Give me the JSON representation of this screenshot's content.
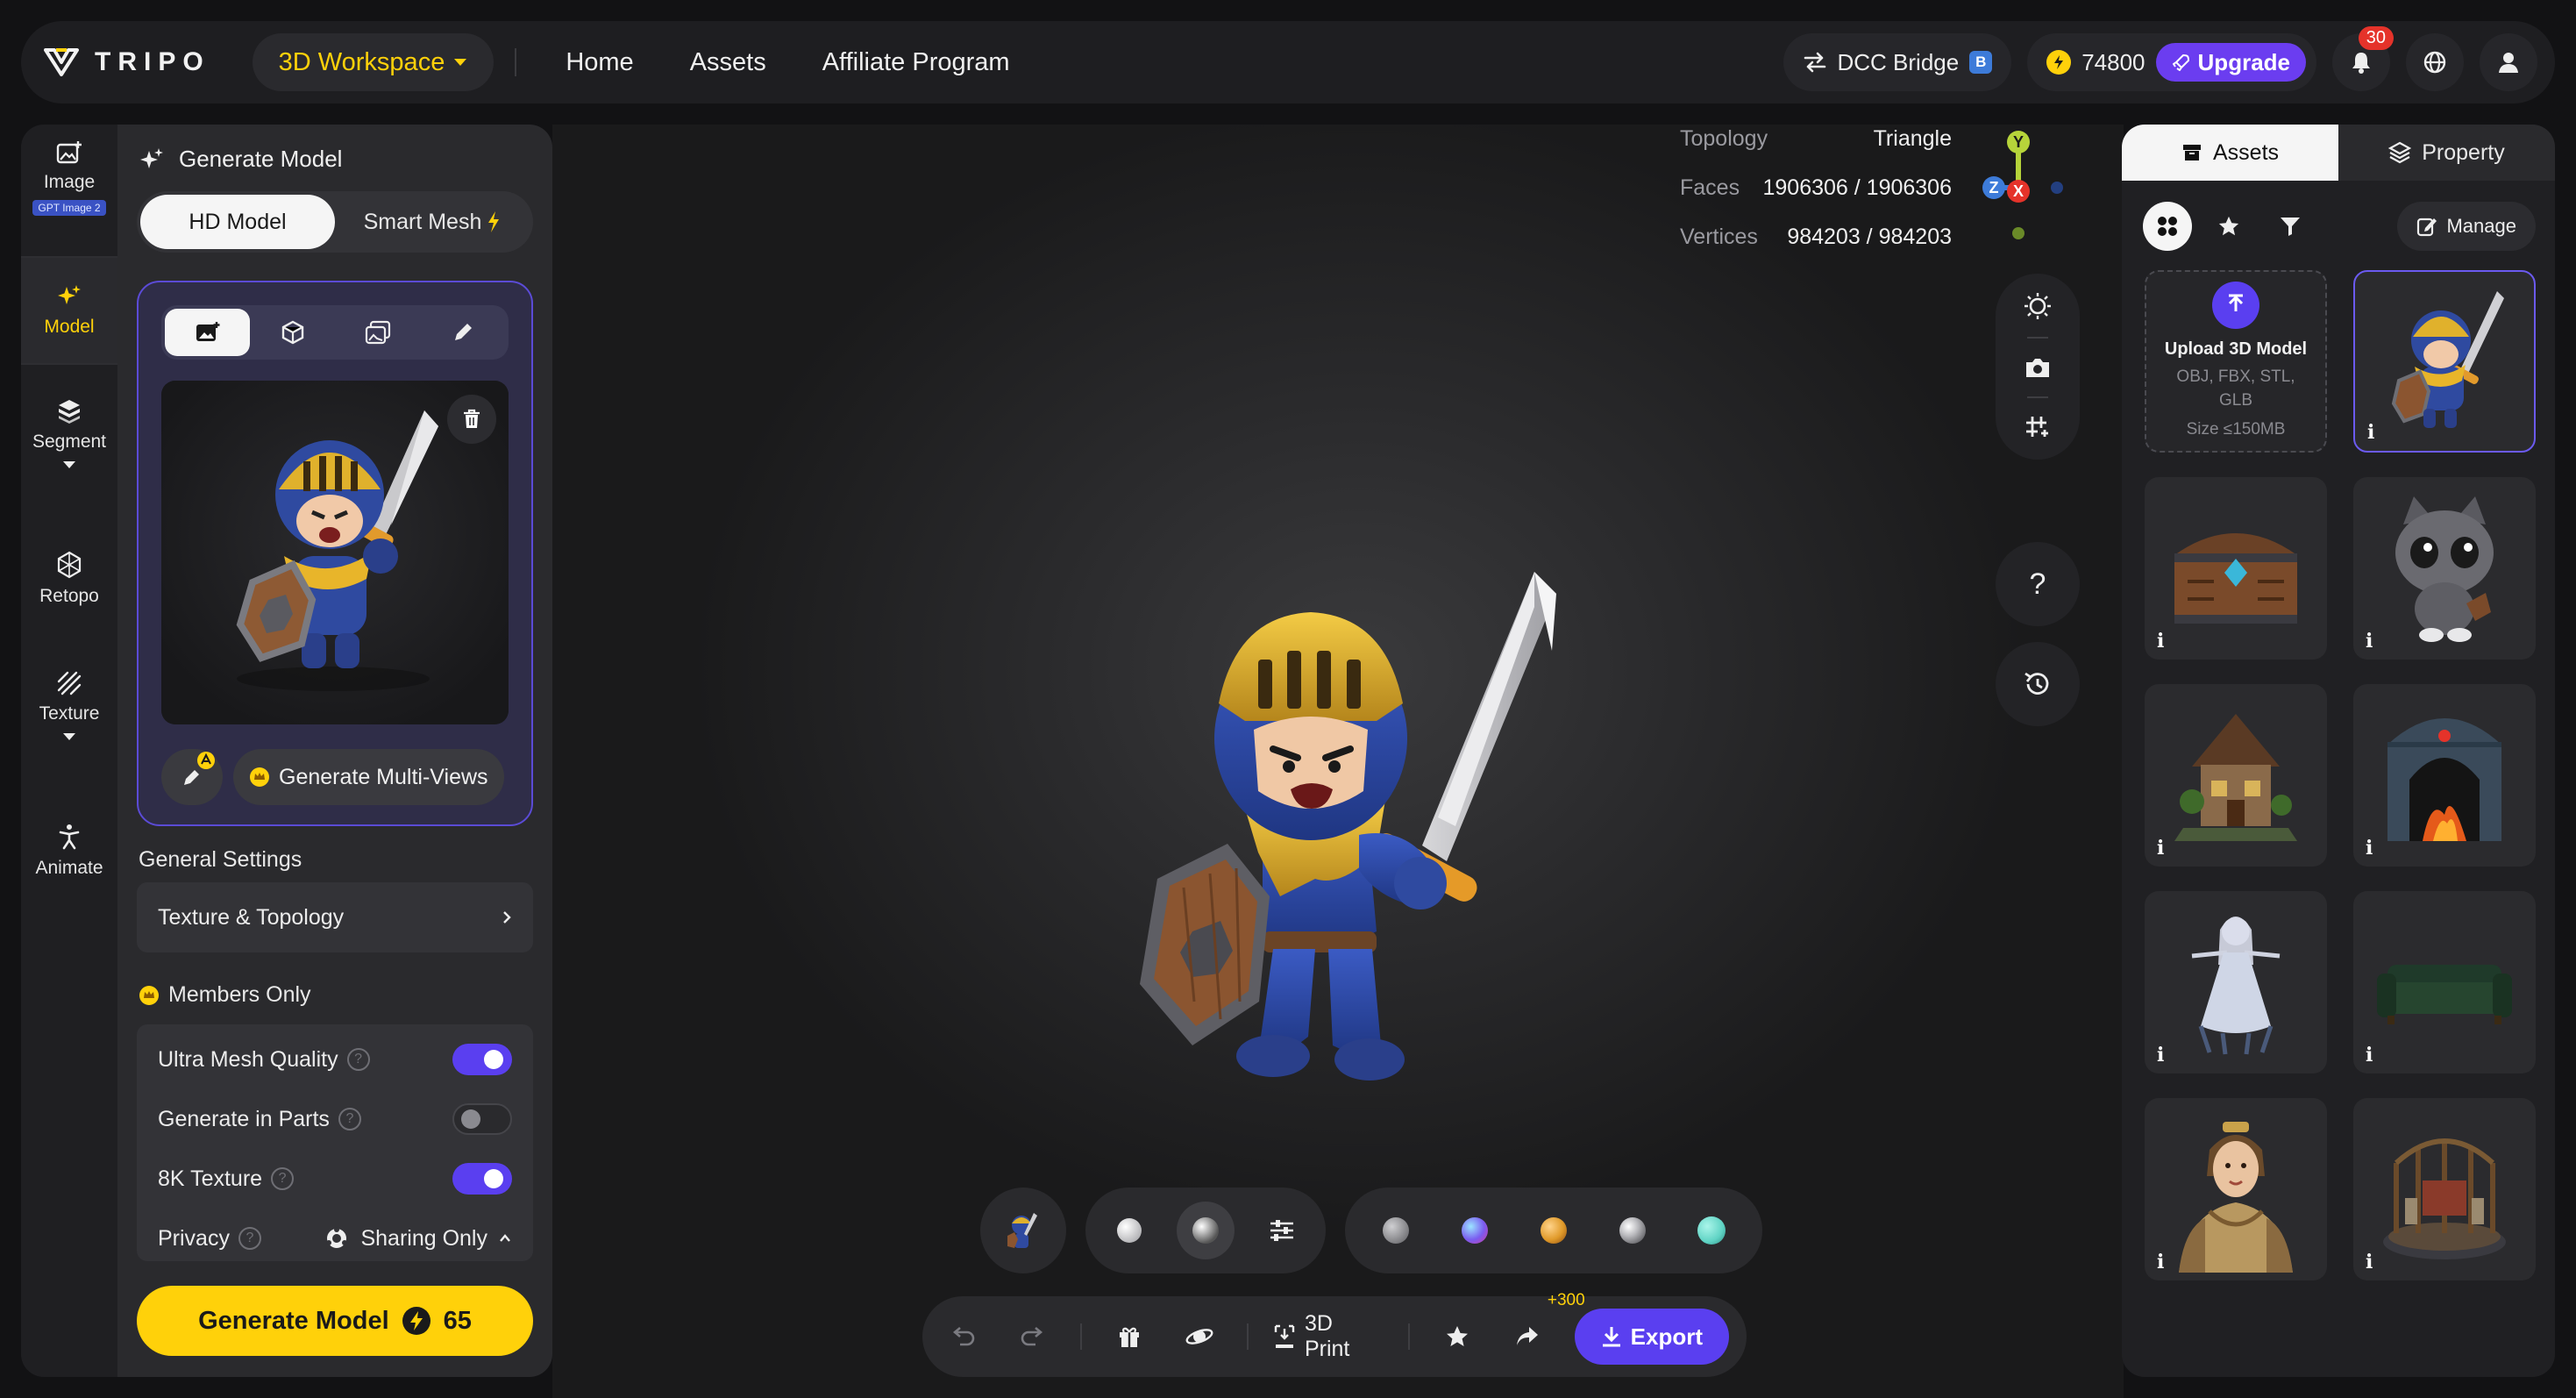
{
  "brand": {
    "name": "TRIPO"
  },
  "header": {
    "workspace_label": "3D Workspace",
    "nav": [
      "Home",
      "Assets",
      "Affiliate Program"
    ],
    "dcc_label": "DCC Bridge",
    "credits": "74800",
    "upgrade_label": "Upgrade",
    "notification_count": "30"
  },
  "rail": {
    "items": [
      {
        "label": "Image",
        "tag": "GPT Image 2"
      },
      {
        "label": "Model"
      },
      {
        "label": "Segment"
      },
      {
        "label": "Retopo"
      },
      {
        "label": "Texture"
      },
      {
        "label": "Animate"
      }
    ]
  },
  "panel": {
    "title": "Generate Model",
    "modes": [
      "HD Model",
      "Smart Mesh"
    ],
    "multiview_label": "Generate Multi-Views",
    "general_settings_label": "General Settings",
    "texture_topology_label": "Texture & Topology",
    "members_only_label": "Members Only",
    "settings": [
      {
        "label": "Ultra Mesh Quality",
        "on": true
      },
      {
        "label": "Generate in Parts",
        "on": false
      },
      {
        "label": "8K Texture",
        "on": true
      }
    ],
    "privacy_label": "Privacy",
    "privacy_value": "Sharing Only",
    "generate_label": "Generate Model",
    "generate_cost": "65"
  },
  "viewport": {
    "topology_label": "Topology",
    "topology_value": "Triangle",
    "faces_label": "Faces",
    "faces_value": "1906306 / 1906306",
    "vertices_label": "Vertices",
    "vertices_value": "984203 / 984203",
    "axis_labels": [
      "Y",
      "Z",
      "X"
    ],
    "help_label": "?",
    "print_label": "3D Print",
    "bonus_label": "+300",
    "export_label": "Export"
  },
  "colors": {
    "accent_yellow": "#ffd10a",
    "accent_purple": "#5a3ff0",
    "material_swatches": [
      "#cfcfd2",
      "#8a8a8e",
      "#7a5cf0",
      "#e09a2a",
      "#b8b8bc",
      "#5fd3c4"
    ]
  },
  "assets": {
    "tabs": [
      "Assets",
      "Property"
    ],
    "manage_label": "Manage",
    "upload_title": "Upload 3D Model",
    "upload_formats": "OBJ, FBX, STL, GLB",
    "upload_size": "Size ≤150MB",
    "info_glyph": "i"
  }
}
